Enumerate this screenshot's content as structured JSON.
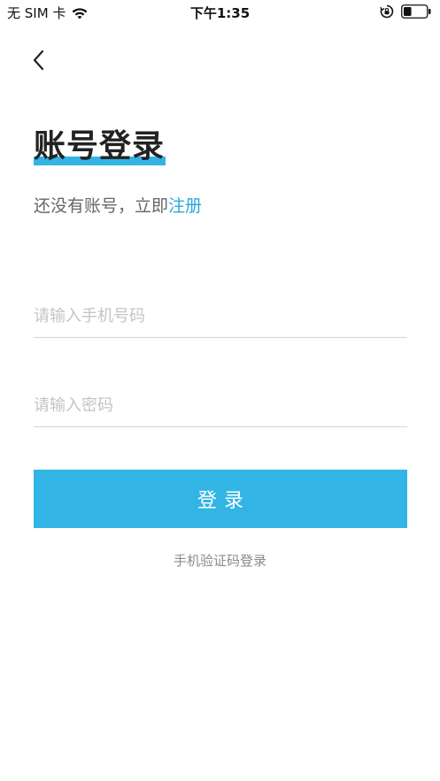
{
  "status_bar": {
    "carrier": "无 SIM 卡",
    "time": "下午1:35",
    "icons": [
      "wifi-icon",
      "rotation-lock-icon",
      "battery-icon"
    ],
    "battery_level": 0.35
  },
  "nav": {
    "back_icon": "chevron-left-icon"
  },
  "header": {
    "title": "账号登录",
    "underline_color": "#32b5e5"
  },
  "register": {
    "prompt": "还没有账号，立即",
    "link_label": "注册",
    "link_color": "#2aa7dd"
  },
  "form": {
    "phone": {
      "value": "",
      "placeholder": "请输入手机号码"
    },
    "password": {
      "value": "",
      "placeholder": "请输入密码"
    },
    "submit_label": "登录",
    "submit_color": "#32b5e5"
  },
  "alt_login": {
    "label": "手机验证码登录"
  }
}
